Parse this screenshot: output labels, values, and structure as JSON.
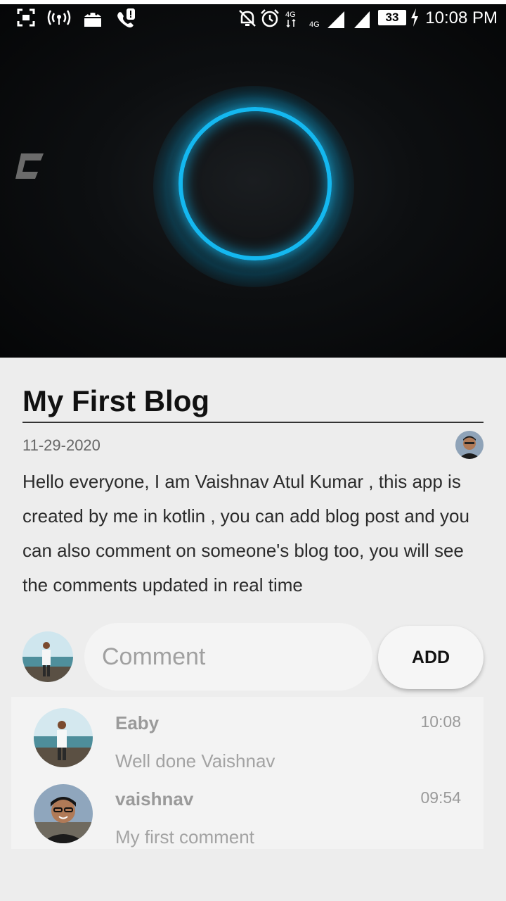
{
  "status_bar": {
    "time": "10:08 PM",
    "battery": "33",
    "icons": [
      "screenshot-icon",
      "hotspot-icon",
      "android-debug-icon",
      "call-alert-icon",
      "mute-icon",
      "alarm-icon",
      "4g-icon",
      "signal-icon",
      "signal-icon-2",
      "charging-icon"
    ]
  },
  "hero": {
    "logo_letter": "C",
    "ring_color": "#14b8f0"
  },
  "blog": {
    "title": "My First Blog",
    "date": "11-29-2020",
    "body": "Hello everyone, I am Vaishnav Atul Kumar , this app is created by me in kotlin , you can add blog post and you can also comment on someone's blog too, you will see the comments updated in real time"
  },
  "composer": {
    "placeholder": "Comment",
    "add_label": "ADD"
  },
  "comments": [
    {
      "name": "Eaby",
      "time": "10:08",
      "text": "Well done Vaishnav"
    },
    {
      "name": "vaishnav",
      "time": "09:54",
      "text": "My first comment"
    }
  ]
}
